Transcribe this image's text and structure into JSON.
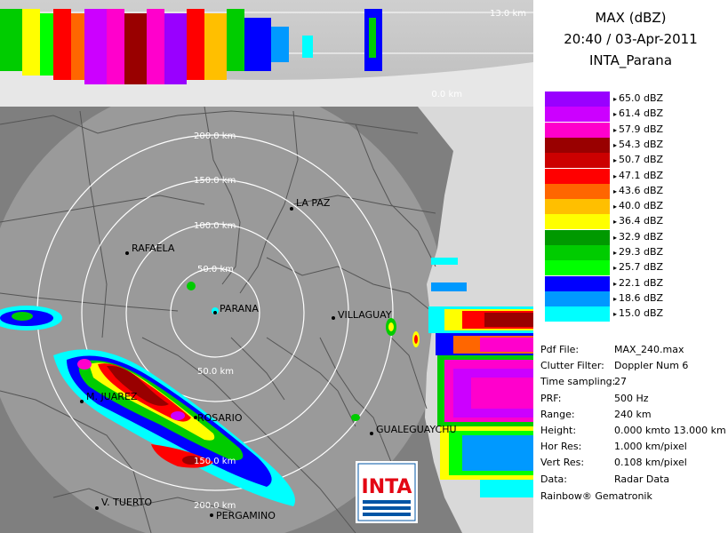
{
  "header": {
    "product": "MAX (dBZ)",
    "datetime": "20:40 / 03-Apr-2011",
    "site": "INTA_Parana"
  },
  "height_labels": {
    "top": "13.0 km",
    "bottom": "0.0 km"
  },
  "range_rings": [
    "50.0 km",
    "100.0 km",
    "150.0 km",
    "200.0 km"
  ],
  "range_labels_lower": [
    "50.0 km",
    "150.0 km",
    "200.0 km"
  ],
  "cities": [
    "RAFAELA",
    "LA PAZ",
    "PARANA",
    "VILLAGUAY",
    "M. JUAREZ",
    "ROSARIO",
    "GUALEGUAYCHU",
    "V. TUERTO",
    "PERGAMINO"
  ],
  "legend": [
    {
      "label": "65.0 dBZ",
      "color": "#9900ff"
    },
    {
      "label": "61.4 dBZ",
      "color": "#cc00ff"
    },
    {
      "label": "57.9 dBZ",
      "color": "#ff00cc"
    },
    {
      "label": "54.3 dBZ",
      "color": "#990000"
    },
    {
      "label": "50.7 dBZ",
      "color": "#cc0000"
    },
    {
      "label": "47.1 dBZ",
      "color": "#ff0000"
    },
    {
      "label": "43.6 dBZ",
      "color": "#ff6600"
    },
    {
      "label": "40.0 dBZ",
      "color": "#ffbf00"
    },
    {
      "label": "36.4 dBZ",
      "color": "#ffff00"
    },
    {
      "label": "32.9 dBZ",
      "color": "#009900"
    },
    {
      "label": "29.3 dBZ",
      "color": "#00cc00"
    },
    {
      "label": "25.7 dBZ",
      "color": "#00ff00"
    },
    {
      "label": "22.1 dBZ",
      "color": "#0000ff"
    },
    {
      "label": "18.6 dBZ",
      "color": "#0099ff"
    },
    {
      "label": "15.0 dBZ",
      "color": "#00ffff"
    }
  ],
  "info": [
    {
      "key": "Pdf File:",
      "value": "MAX_240.max"
    },
    {
      "key": "Clutter Filter:",
      "value": "Doppler Num 6"
    },
    {
      "key": "Time sampling:",
      "value": "27"
    },
    {
      "key": "PRF:",
      "value": "500 Hz"
    },
    {
      "key": "Range:",
      "value": "240 km"
    },
    {
      "key": "Height:",
      "value": "0.000 kmto 13.000 km"
    },
    {
      "key": "Hor Res:",
      "value": "1.000 km/pixel"
    },
    {
      "key": "Vert Res:",
      "value": "0.108 km/pixel"
    },
    {
      "key": "Data:",
      "value": "Radar Data"
    }
  ],
  "footer": "Rainbow® Gematronik",
  "logo_text": "INTA"
}
